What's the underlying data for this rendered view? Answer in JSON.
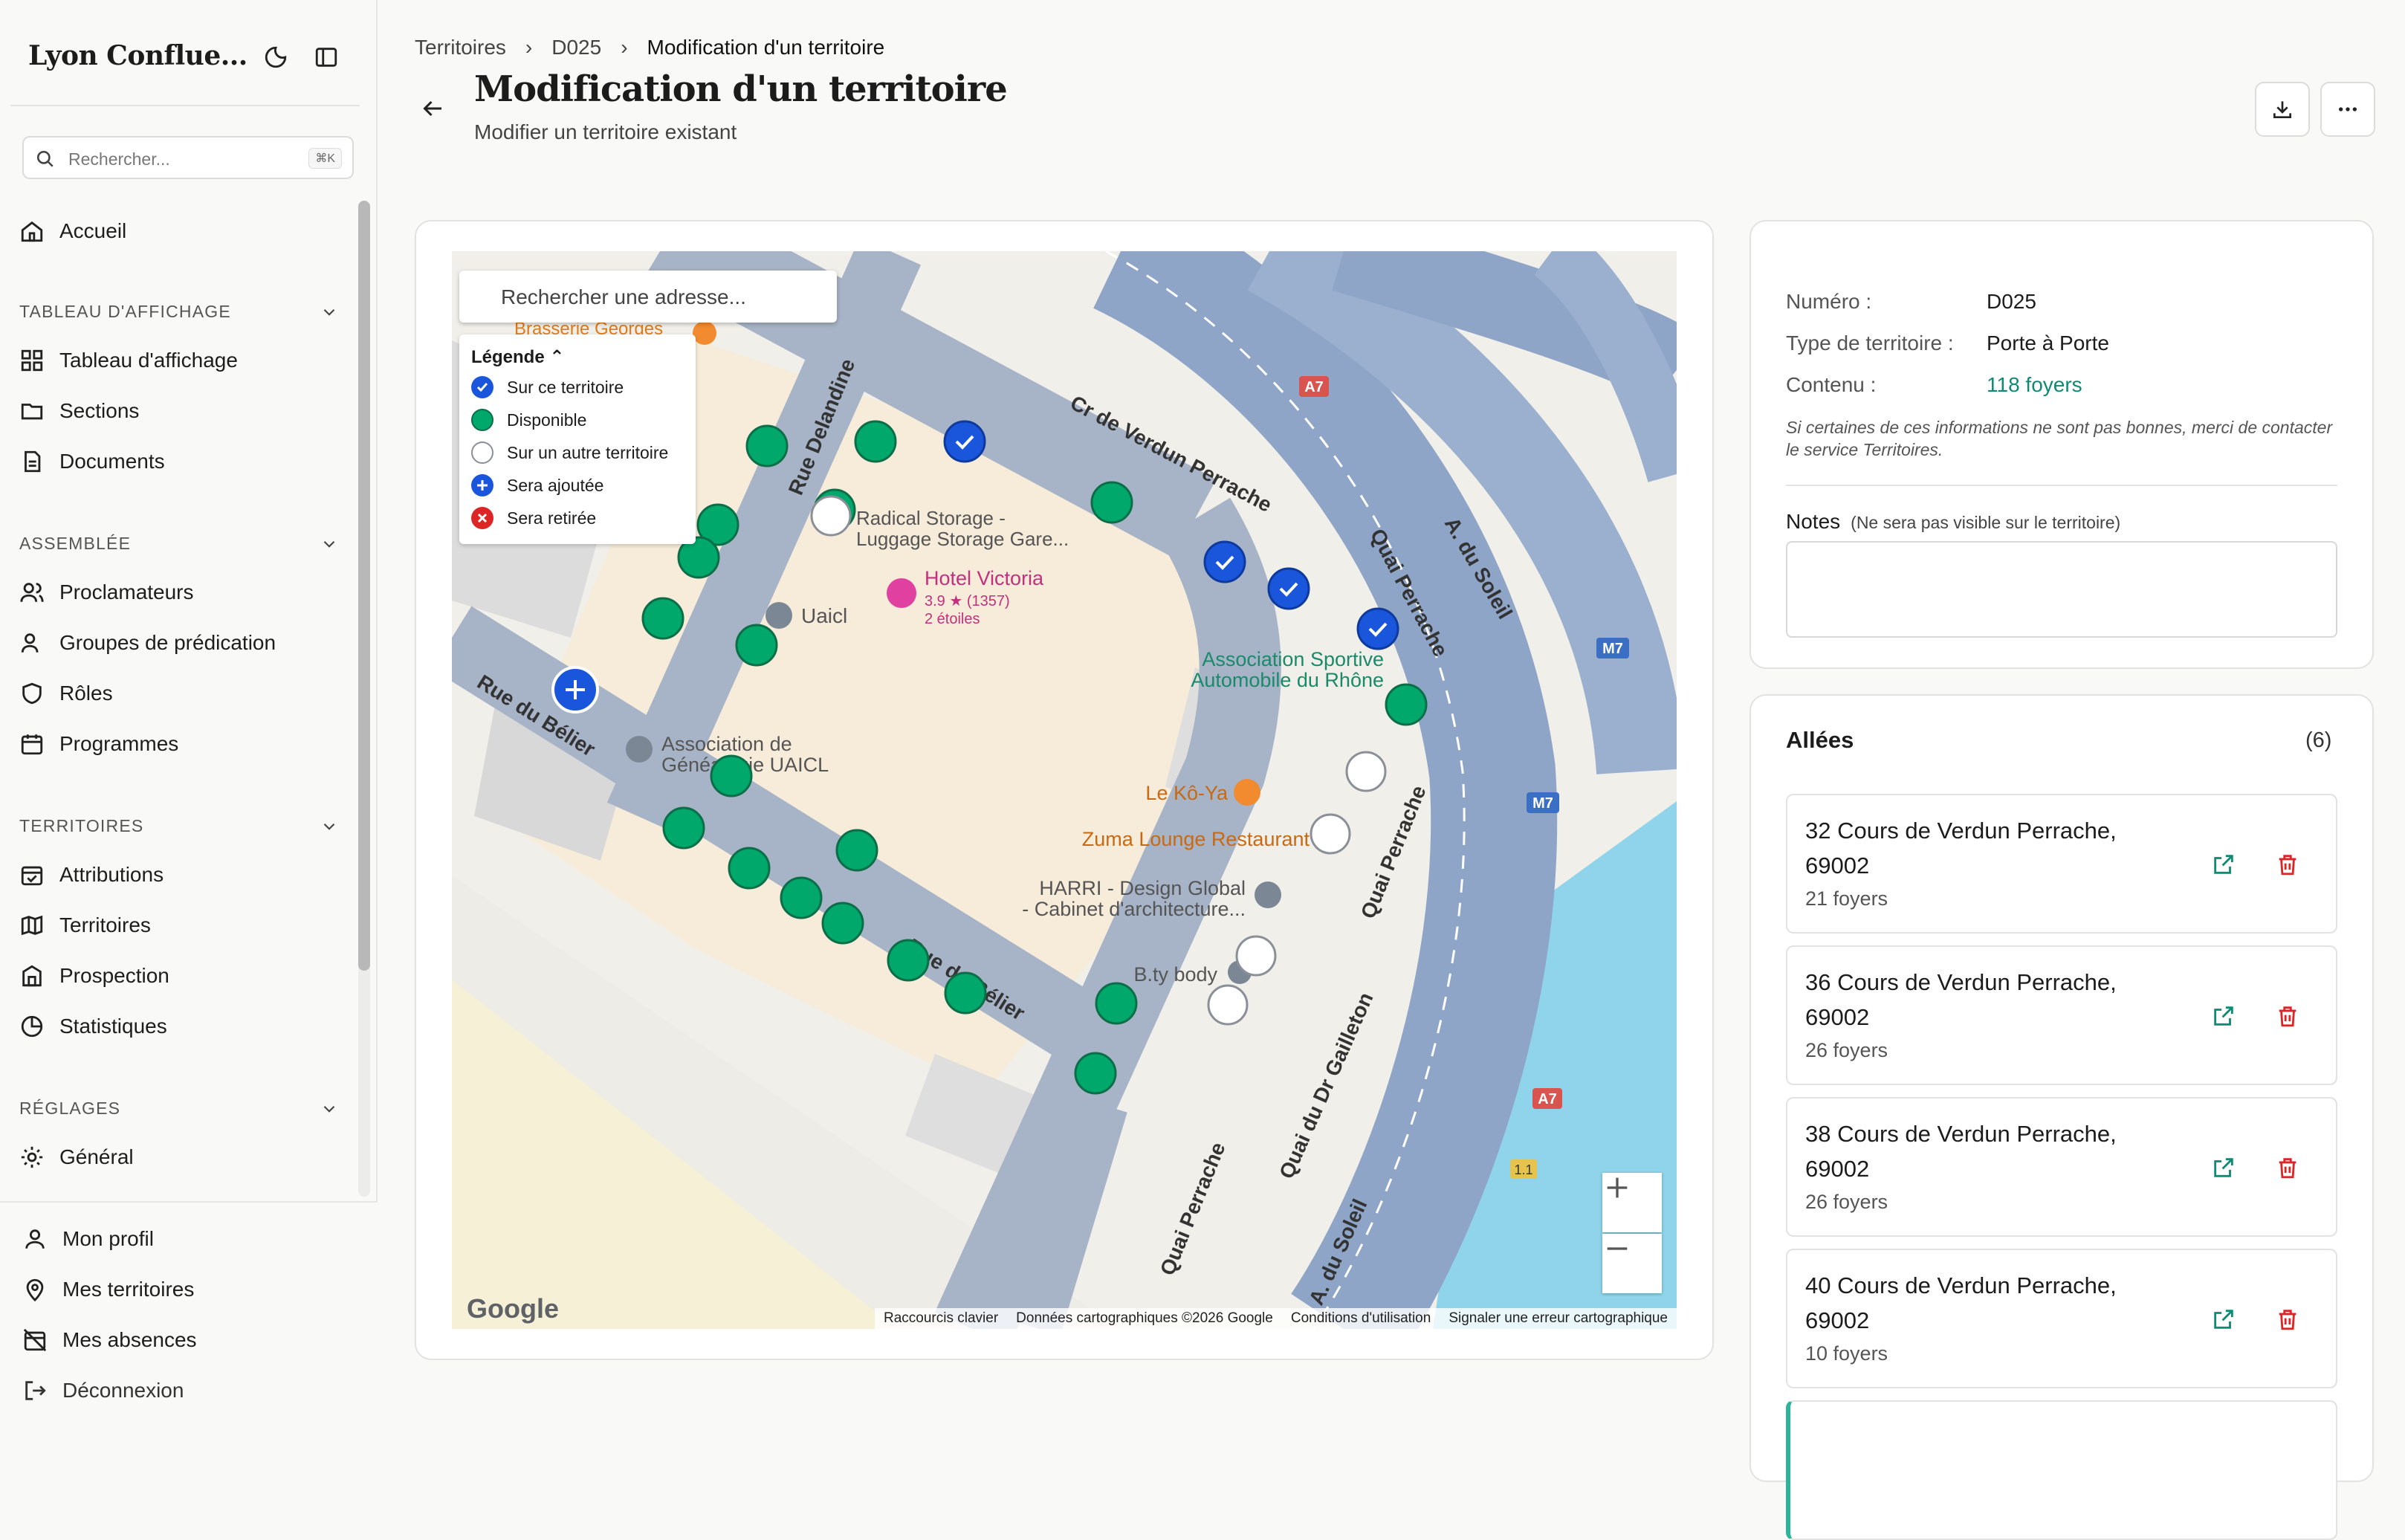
{
  "sidebar": {
    "brand": "Lyon Conflue...",
    "search_placeholder": "Rechercher...",
    "search_kbd": "⌘K",
    "home": "Accueil",
    "sections": [
      {
        "title": "TABLEAU D'AFFICHAGE",
        "items": [
          "Tableau d'affichage",
          "Sections",
          "Documents"
        ]
      },
      {
        "title": "ASSEMBLÉE",
        "items": [
          "Proclamateurs",
          "Groupes de prédication",
          "Rôles",
          "Programmes"
        ]
      },
      {
        "title": "TERRITOIRES",
        "items": [
          "Attributions",
          "Territoires",
          "Prospection",
          "Statistiques"
        ]
      },
      {
        "title": "RÉGLAGES",
        "items": [
          "Général"
        ]
      }
    ],
    "bottom": [
      "Mon profil",
      "Mes territoires",
      "Mes absences",
      "Déconnexion"
    ]
  },
  "breadcrumb": [
    "Territoires",
    "D025",
    "Modification d'un territoire"
  ],
  "page": {
    "title": "Modification d'un territoire",
    "subtitle": "Modifier un territoire existant"
  },
  "map": {
    "search_placeholder": "Rechercher une adresse...",
    "legend_title": "Légende",
    "legend": [
      {
        "label": "Sur ce territoire",
        "color": "#1a56db"
      },
      {
        "label": "Disponible",
        "color": "#00a86b"
      },
      {
        "label": "Sur un autre territoire",
        "color": "#ffffff"
      },
      {
        "label": "Sera ajoutée",
        "color": "#1a56db"
      },
      {
        "label": "Sera retirée",
        "color": "#dc2626"
      }
    ],
    "labels": {
      "brasserie": "Brasserie Georges",
      "radical1": "Radical Storage -",
      "radical2": "Luggage Storage Gare...",
      "hotel": "Hotel Victoria",
      "hotel_rating": "3.9 ★ (1357)",
      "hotel_stars": "2 étoiles",
      "uaicl": "Uaicl",
      "asso1": "Association de",
      "asso2": "Généalogie UAICL",
      "sport1": "Association Sportive",
      "sport2": "Automobile du Rhône",
      "koya": "Le Kô-Ya",
      "zuma": "Zuma Lounge Restaurant",
      "harri1": "HARRI - Design Global",
      "harri2": "- Cabinet d'architecture...",
      "bty": "B.ty body",
      "rue_delandine": "Rue Delandine",
      "cr_verdun": "Cr de Verdun Perrache",
      "quai_perrache": "Quai Perrache",
      "a_soleil": "A. du Soleil",
      "rue_belier": "Rue du Bélier",
      "quai_gailleton": "Quai du Dr Gailleton",
      "a7": "A7",
      "m7": "M7",
      "n11": "1.1"
    },
    "attribution": [
      "Raccourcis clavier",
      "Données cartographiques ©2026 Google",
      "Conditions d'utilisation",
      "Signaler une erreur cartographique"
    ],
    "google": "Google"
  },
  "info": {
    "numero_label": "Numéro :",
    "numero": "D025",
    "type_label": "Type de territoire :",
    "type": "Porte à Porte",
    "contenu_label": "Contenu :",
    "contenu": "118 foyers",
    "note": "Si certaines de ces informations ne sont pas bonnes, merci de contacter le service Territoires.",
    "notes_label": "Notes",
    "notes_hint": "(Ne sera pas visible sur le territoire)"
  },
  "allees": {
    "title": "Allées",
    "count": "(6)",
    "items": [
      {
        "addr": "32 Cours de Verdun Perrache, 69002",
        "count": "21 foyers"
      },
      {
        "addr": "36 Cours de Verdun Perrache, 69002",
        "count": "26 foyers"
      },
      {
        "addr": "38 Cours de Verdun Perrache, 69002",
        "count": "26 foyers"
      },
      {
        "addr": "40 Cours de Verdun Perrache, 69002",
        "count": "10 foyers"
      }
    ]
  }
}
